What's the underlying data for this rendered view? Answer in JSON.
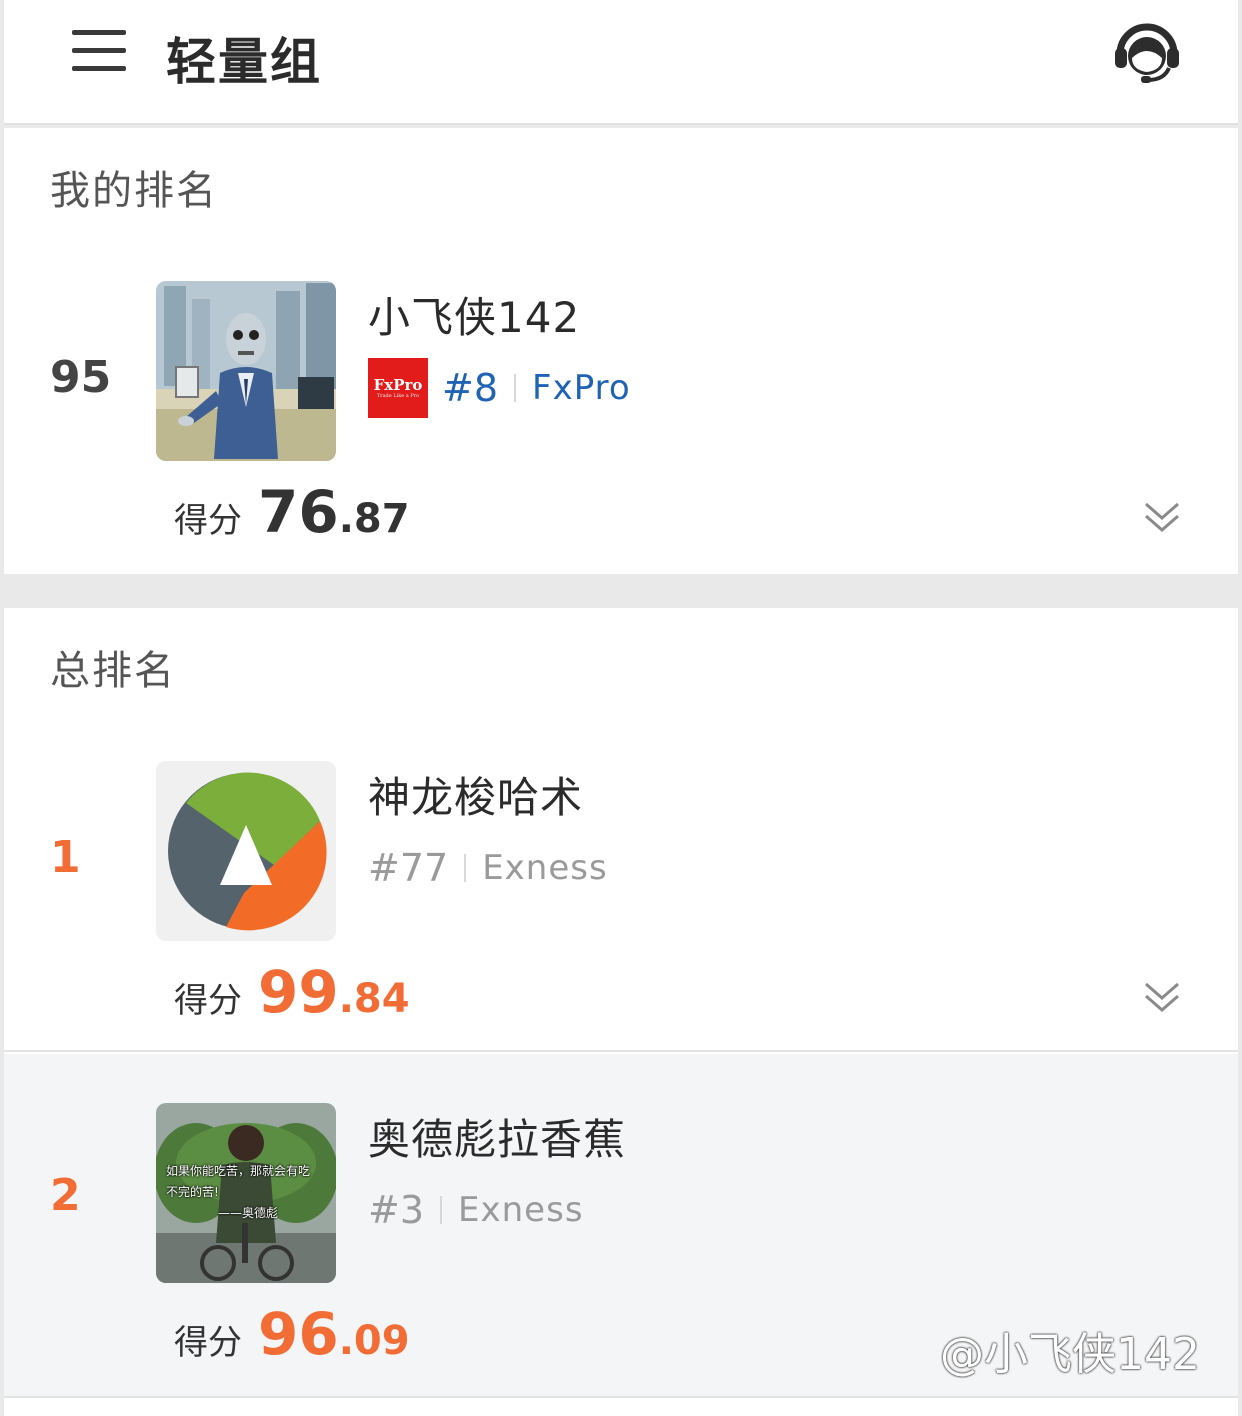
{
  "header": {
    "title": "轻量组",
    "menu_icon": "hamburger-menu-icon",
    "support_icon": "customer-service-headset-icon"
  },
  "my_rank": {
    "section_title": "我的排名",
    "rank": "95",
    "name": "小飞侠142",
    "broker_logo_text": "FxPro",
    "broker_logo_subtext": "Trade Like a Pro",
    "account": "#8",
    "broker": "FxPro",
    "score_label": "得分",
    "score_int": "76",
    "score_dec": ".87"
  },
  "overall": {
    "section_title": "总排名",
    "entries": [
      {
        "rank": "1",
        "name": "神龙梭哈术",
        "account": "#77",
        "broker": "Exness",
        "score_label": "得分",
        "score_int": "99",
        "score_dec": ".84"
      },
      {
        "rank": "2",
        "name": "奥德彪拉香蕉",
        "account": "#3",
        "broker": "Exness",
        "score_label": "得分",
        "score_int": "96",
        "score_dec": ".09",
        "avatar_caption_1": "如果你能吃苦，那就会有吃",
        "avatar_caption_2": "不完的苦!",
        "avatar_caption_3": "——奥德彪"
      }
    ]
  },
  "watermark": "@小飞侠142",
  "colors": {
    "accent_orange": "#f26c36",
    "accent_blue": "#1f63b5",
    "muted_gray": "#9a9a9a",
    "rank_dark": "#444444"
  }
}
